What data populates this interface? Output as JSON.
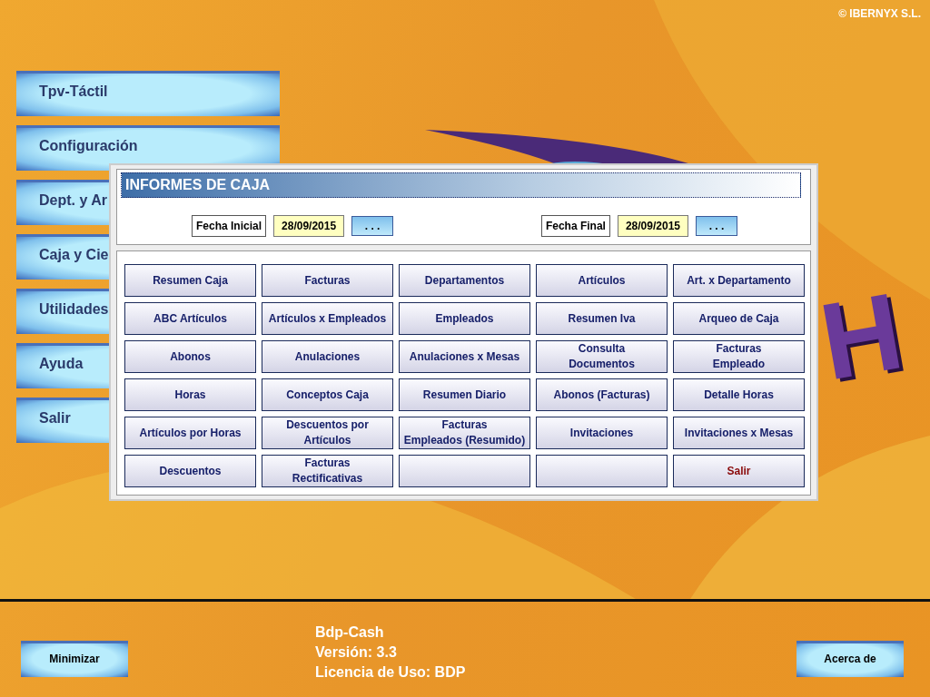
{
  "copyright": "© IBERNYX S.L.",
  "logo": {
    "letter": "H"
  },
  "sidebar": {
    "items": [
      {
        "label": "Tpv-Táctil"
      },
      {
        "label": "Configuración"
      },
      {
        "label": "Dept. y Ar"
      },
      {
        "label": "Caja y Cie"
      },
      {
        "label": "Utilidades"
      },
      {
        "label": "Ayuda"
      },
      {
        "label": "Salir"
      }
    ]
  },
  "dialog": {
    "title": "INFORMES DE CAJA",
    "dates": [
      {
        "label": "Fecha Inicial",
        "value": "28/09/2015",
        "button": ". . ."
      },
      {
        "label": "Fecha Final",
        "value": "28/09/2015",
        "button": ". . ."
      }
    ],
    "reports": [
      {
        "kind": "report",
        "label": "Resumen Caja"
      },
      {
        "kind": "report",
        "label": "Facturas"
      },
      {
        "kind": "report",
        "label": "Departamentos"
      },
      {
        "kind": "report",
        "label": "Artículos"
      },
      {
        "kind": "report",
        "label": "Art. x Departamento"
      },
      {
        "kind": "report",
        "label": "ABC Artículos"
      },
      {
        "kind": "report",
        "label": "Artículos x Empleados"
      },
      {
        "kind": "report",
        "label": "Empleados"
      },
      {
        "kind": "report",
        "label": "Resumen Iva"
      },
      {
        "kind": "report",
        "label": "Arqueo de Caja"
      },
      {
        "kind": "report",
        "label": "Abonos"
      },
      {
        "kind": "report",
        "label": "Anulaciones"
      },
      {
        "kind": "report",
        "label": "Anulaciones x Mesas"
      },
      {
        "kind": "report",
        "label": "Consulta\nDocumentos"
      },
      {
        "kind": "report",
        "label": "Facturas\nEmpleado"
      },
      {
        "kind": "report",
        "label": "Horas"
      },
      {
        "kind": "report",
        "label": "Conceptos Caja"
      },
      {
        "kind": "report",
        "label": "Resumen Diario"
      },
      {
        "kind": "report",
        "label": "Abonos (Facturas)"
      },
      {
        "kind": "report",
        "label": "Detalle Horas"
      },
      {
        "kind": "report",
        "label": "Artículos por Horas"
      },
      {
        "kind": "report",
        "label": "Descuentos por\nArtículos"
      },
      {
        "kind": "report",
        "label": "Facturas\nEmpleados (Resumido)"
      },
      {
        "kind": "report",
        "label": "Invitaciones"
      },
      {
        "kind": "report",
        "label": "Invitaciones x Mesas"
      },
      {
        "kind": "report",
        "label": "Descuentos"
      },
      {
        "kind": "report",
        "label": "Facturas\nRectificativas"
      },
      {
        "kind": "blank"
      },
      {
        "kind": "blank"
      },
      {
        "kind": "exit",
        "label": "Salir"
      }
    ]
  },
  "footer": {
    "minimize": "Minimizar",
    "info": [
      "Bdp-Cash",
      "Versión: 3.3",
      "Licencia de Uso: BDP"
    ],
    "about": "Acerca de"
  }
}
